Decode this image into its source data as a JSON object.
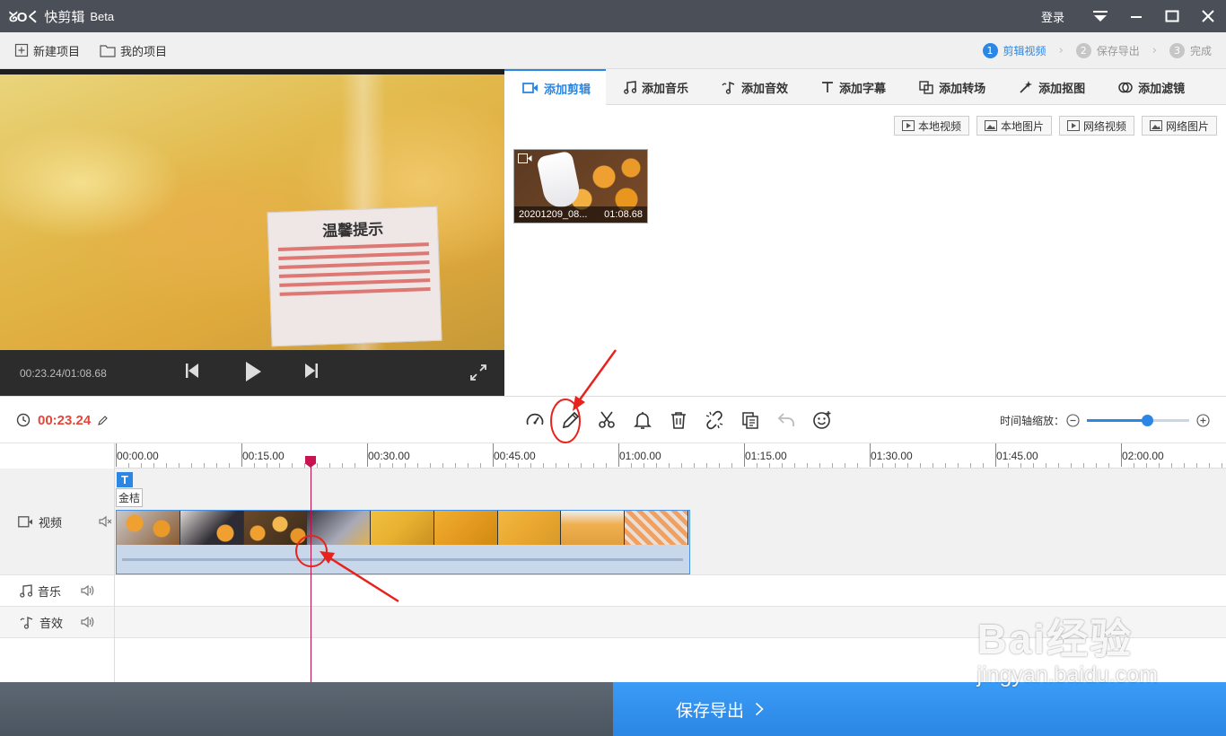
{
  "app": {
    "logo_mark": "ᘜOく",
    "name": "快剪辑",
    "edition": "Beta",
    "login": "登录"
  },
  "toolbar": {
    "new_project": "新建项目",
    "my_projects": "我的项目"
  },
  "steps": [
    {
      "num": "1",
      "label": "剪辑视频",
      "active": true
    },
    {
      "num": "2",
      "label": "保存导出",
      "active": false
    },
    {
      "num": "3",
      "label": "完成",
      "active": false
    }
  ],
  "preview": {
    "time": "00:23.24/01:08.68",
    "sticker_title": "温馨提示"
  },
  "library": {
    "tabs": [
      "添加剪辑",
      "添加音乐",
      "添加音效",
      "添加字幕",
      "添加转场",
      "添加抠图",
      "添加滤镜"
    ],
    "buttons": [
      "本地视频",
      "本地图片",
      "网络视频",
      "网络图片"
    ],
    "clip": {
      "name": "20201209_08...",
      "duration": "01:08.68"
    }
  },
  "edit": {
    "current_time": "00:23.24",
    "zoom_label": "时间轴缩放：",
    "zoom_level": 0.59
  },
  "timeline": {
    "ticks": [
      "00:00.00",
      "00:15.00",
      "00:30.00",
      "00:45.00",
      "01:00.00",
      "01:15.00",
      "01:30.00",
      "01:45.00",
      "02:00.00"
    ],
    "tracks": {
      "video": "视频",
      "music": "音乐",
      "sfx": "音效"
    },
    "text_marker": "T",
    "text_clip": "金桔"
  },
  "bottom": {
    "save_export": "保存导出"
  },
  "watermark": {
    "top": "Bai经验",
    "bottom": "jingyan.baidu.com"
  },
  "colors": {
    "accent": "#2b86e4",
    "time_red": "#e4463a",
    "annotation_red": "#e8231e"
  }
}
